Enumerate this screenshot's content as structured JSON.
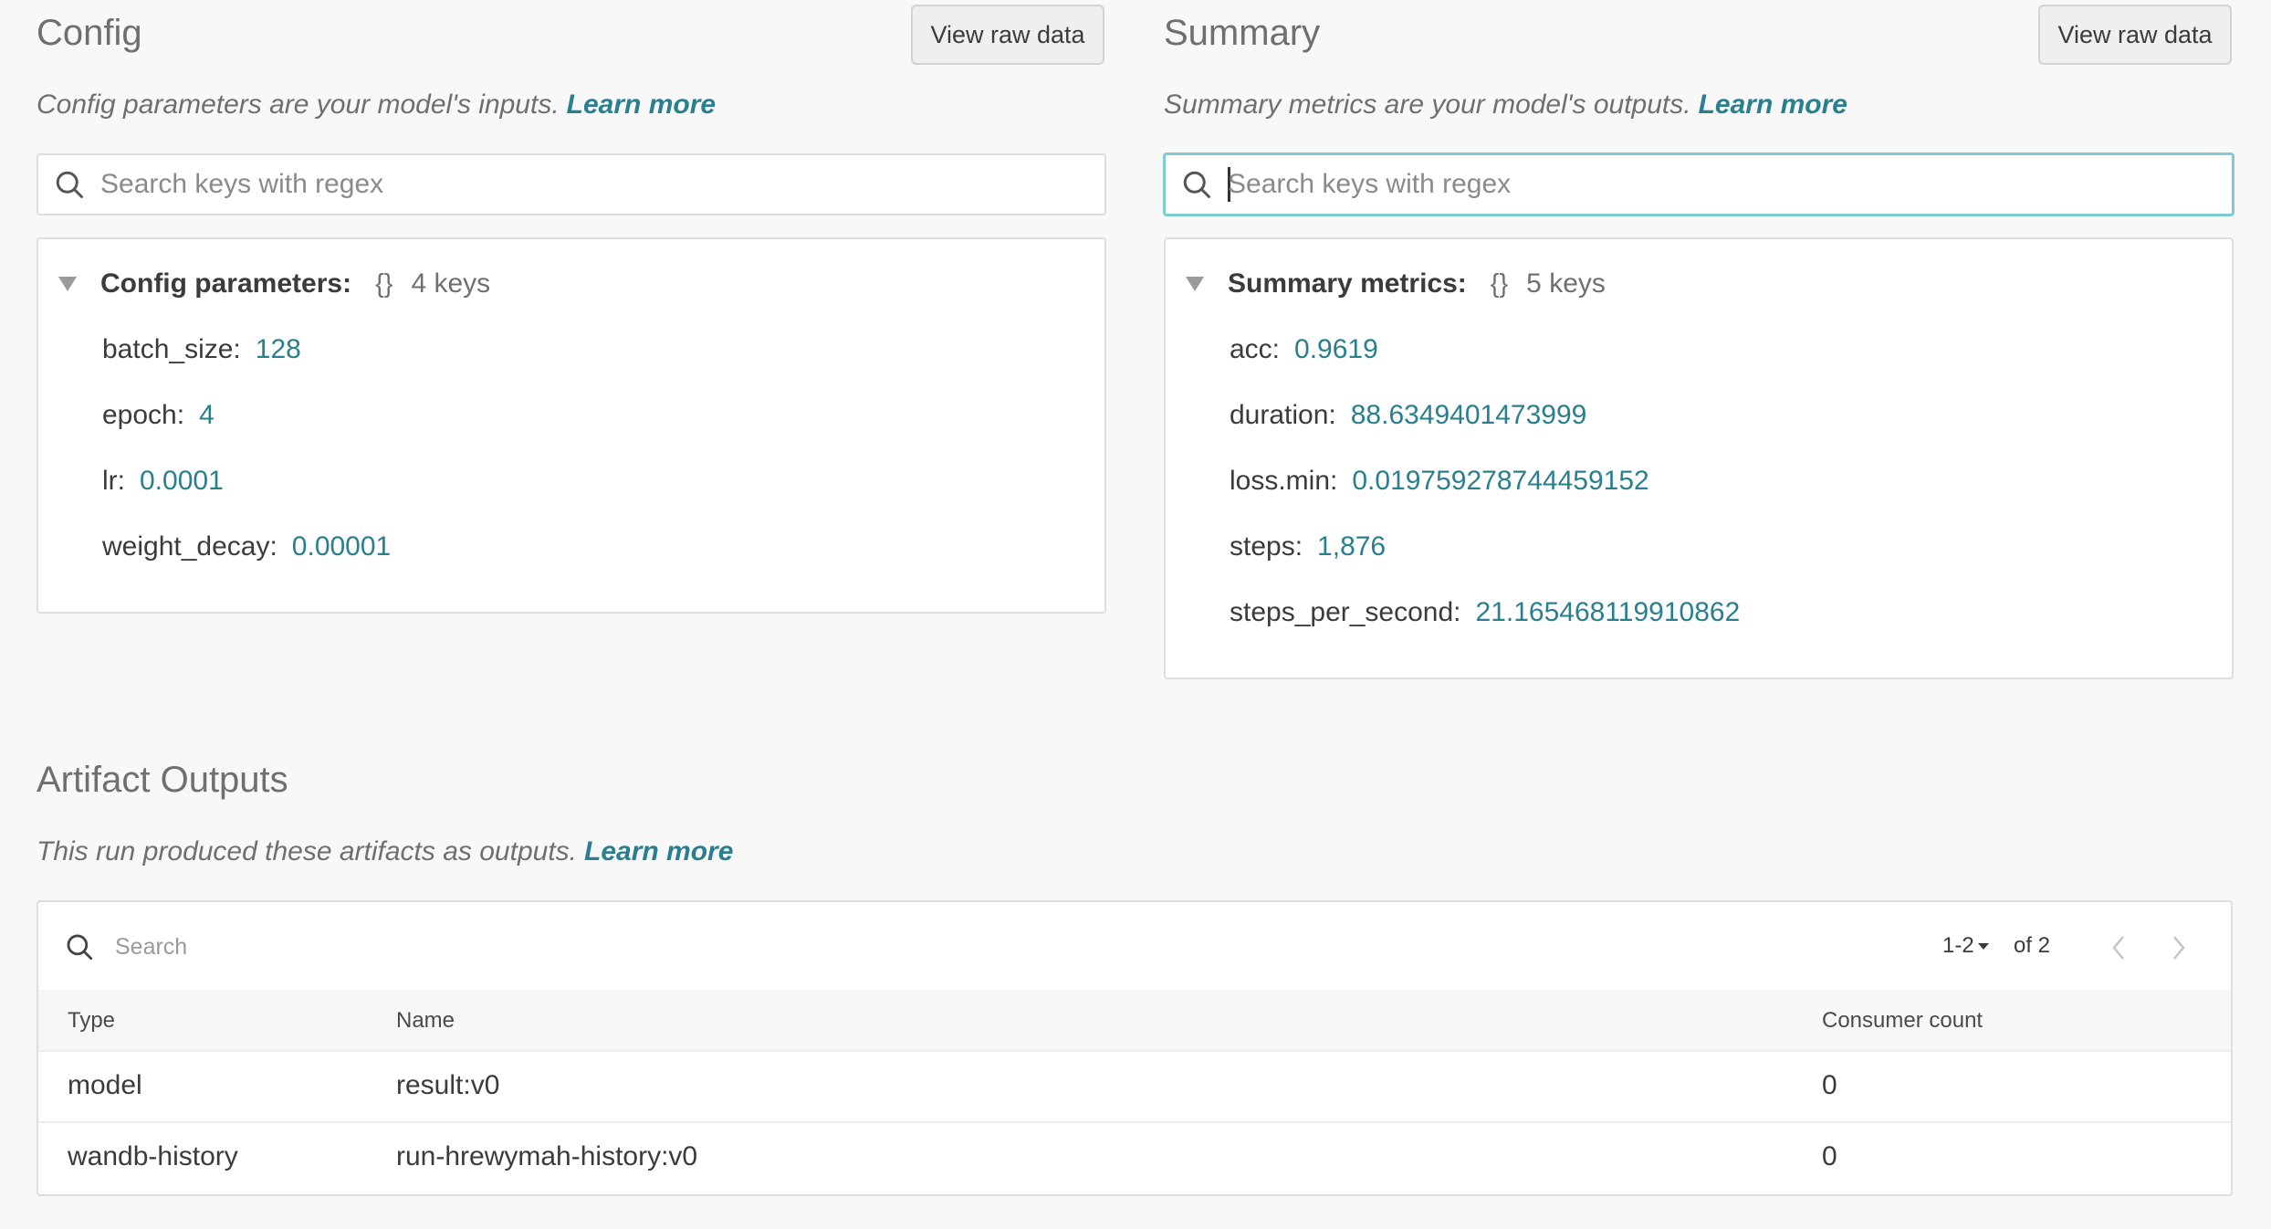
{
  "config": {
    "title": "Config",
    "raw_button": "View raw data",
    "subtitle": "Config parameters are your model's inputs.",
    "learn_more": "Learn more",
    "search_placeholder": "Search keys with regex",
    "tree_title": "Config parameters:",
    "braces": "{}",
    "key_count": "4 keys",
    "items": [
      {
        "key": "batch_size:",
        "value": "128"
      },
      {
        "key": "epoch:",
        "value": "4"
      },
      {
        "key": "lr:",
        "value": "0.0001"
      },
      {
        "key": "weight_decay:",
        "value": "0.00001"
      }
    ]
  },
  "summary": {
    "title": "Summary",
    "raw_button": "View raw data",
    "subtitle": "Summary metrics are your model's outputs.",
    "learn_more": "Learn more",
    "search_placeholder": "Search keys with regex",
    "tree_title": "Summary metrics:",
    "braces": "{}",
    "key_count": "5 keys",
    "items": [
      {
        "key": "acc:",
        "value": "0.9619"
      },
      {
        "key": "duration:",
        "value": "88.6349401473999"
      },
      {
        "key": "loss.min:",
        "value": "0.019759278744459152"
      },
      {
        "key": "steps:",
        "value": "1,876"
      },
      {
        "key": "steps_per_second:",
        "value": "21.165468119910862"
      }
    ]
  },
  "artifacts": {
    "title": "Artifact Outputs",
    "subtitle": "This run produced these artifacts as outputs.",
    "learn_more": "Learn more",
    "search_placeholder": "Search",
    "page_range": "1-2",
    "page_total": "of 2",
    "columns": {
      "type": "Type",
      "name": "Name",
      "consumers": "Consumer count"
    },
    "rows": [
      {
        "type": "model",
        "name": "result:v0",
        "consumers": "0"
      },
      {
        "type": "wandb-history",
        "name": "run-hrewymah-history:v0",
        "consumers": "0"
      }
    ]
  },
  "colors": {
    "accent": "#2a7f8e",
    "focus_border": "#7ecbd4"
  }
}
